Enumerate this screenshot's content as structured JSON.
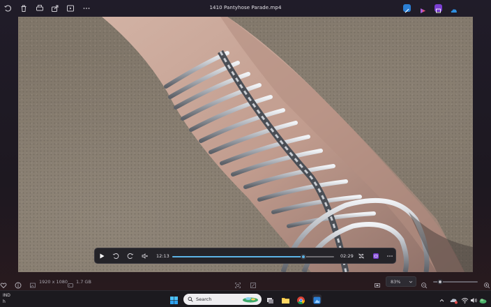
{
  "window": {
    "title": "1410 Pantyhose Parade.mp4"
  },
  "toolbar": {
    "left_icons": [
      "rotate-icon",
      "trash-icon",
      "print-icon",
      "share-icon",
      "slideshow-icon",
      "more-icon"
    ],
    "right_badges": [
      "edit-icon",
      "clipchamp-icon",
      "video-editor-icon",
      "onedrive-icon"
    ]
  },
  "player": {
    "current_time": "12:13",
    "total_time": "02:29",
    "progress_percent": 81
  },
  "status": {
    "dimensions": "1920 x 1080",
    "file_size": "1.7 GB",
    "zoom": "83%",
    "zoom_slider_percent": 15
  },
  "taskbar": {
    "language": "IND",
    "search_placeholder": "Search",
    "lang_second_line": "h"
  },
  "colors": {
    "accent": "#5db4e6",
    "background": "#1f1b25",
    "controls_bg": "#242328"
  }
}
